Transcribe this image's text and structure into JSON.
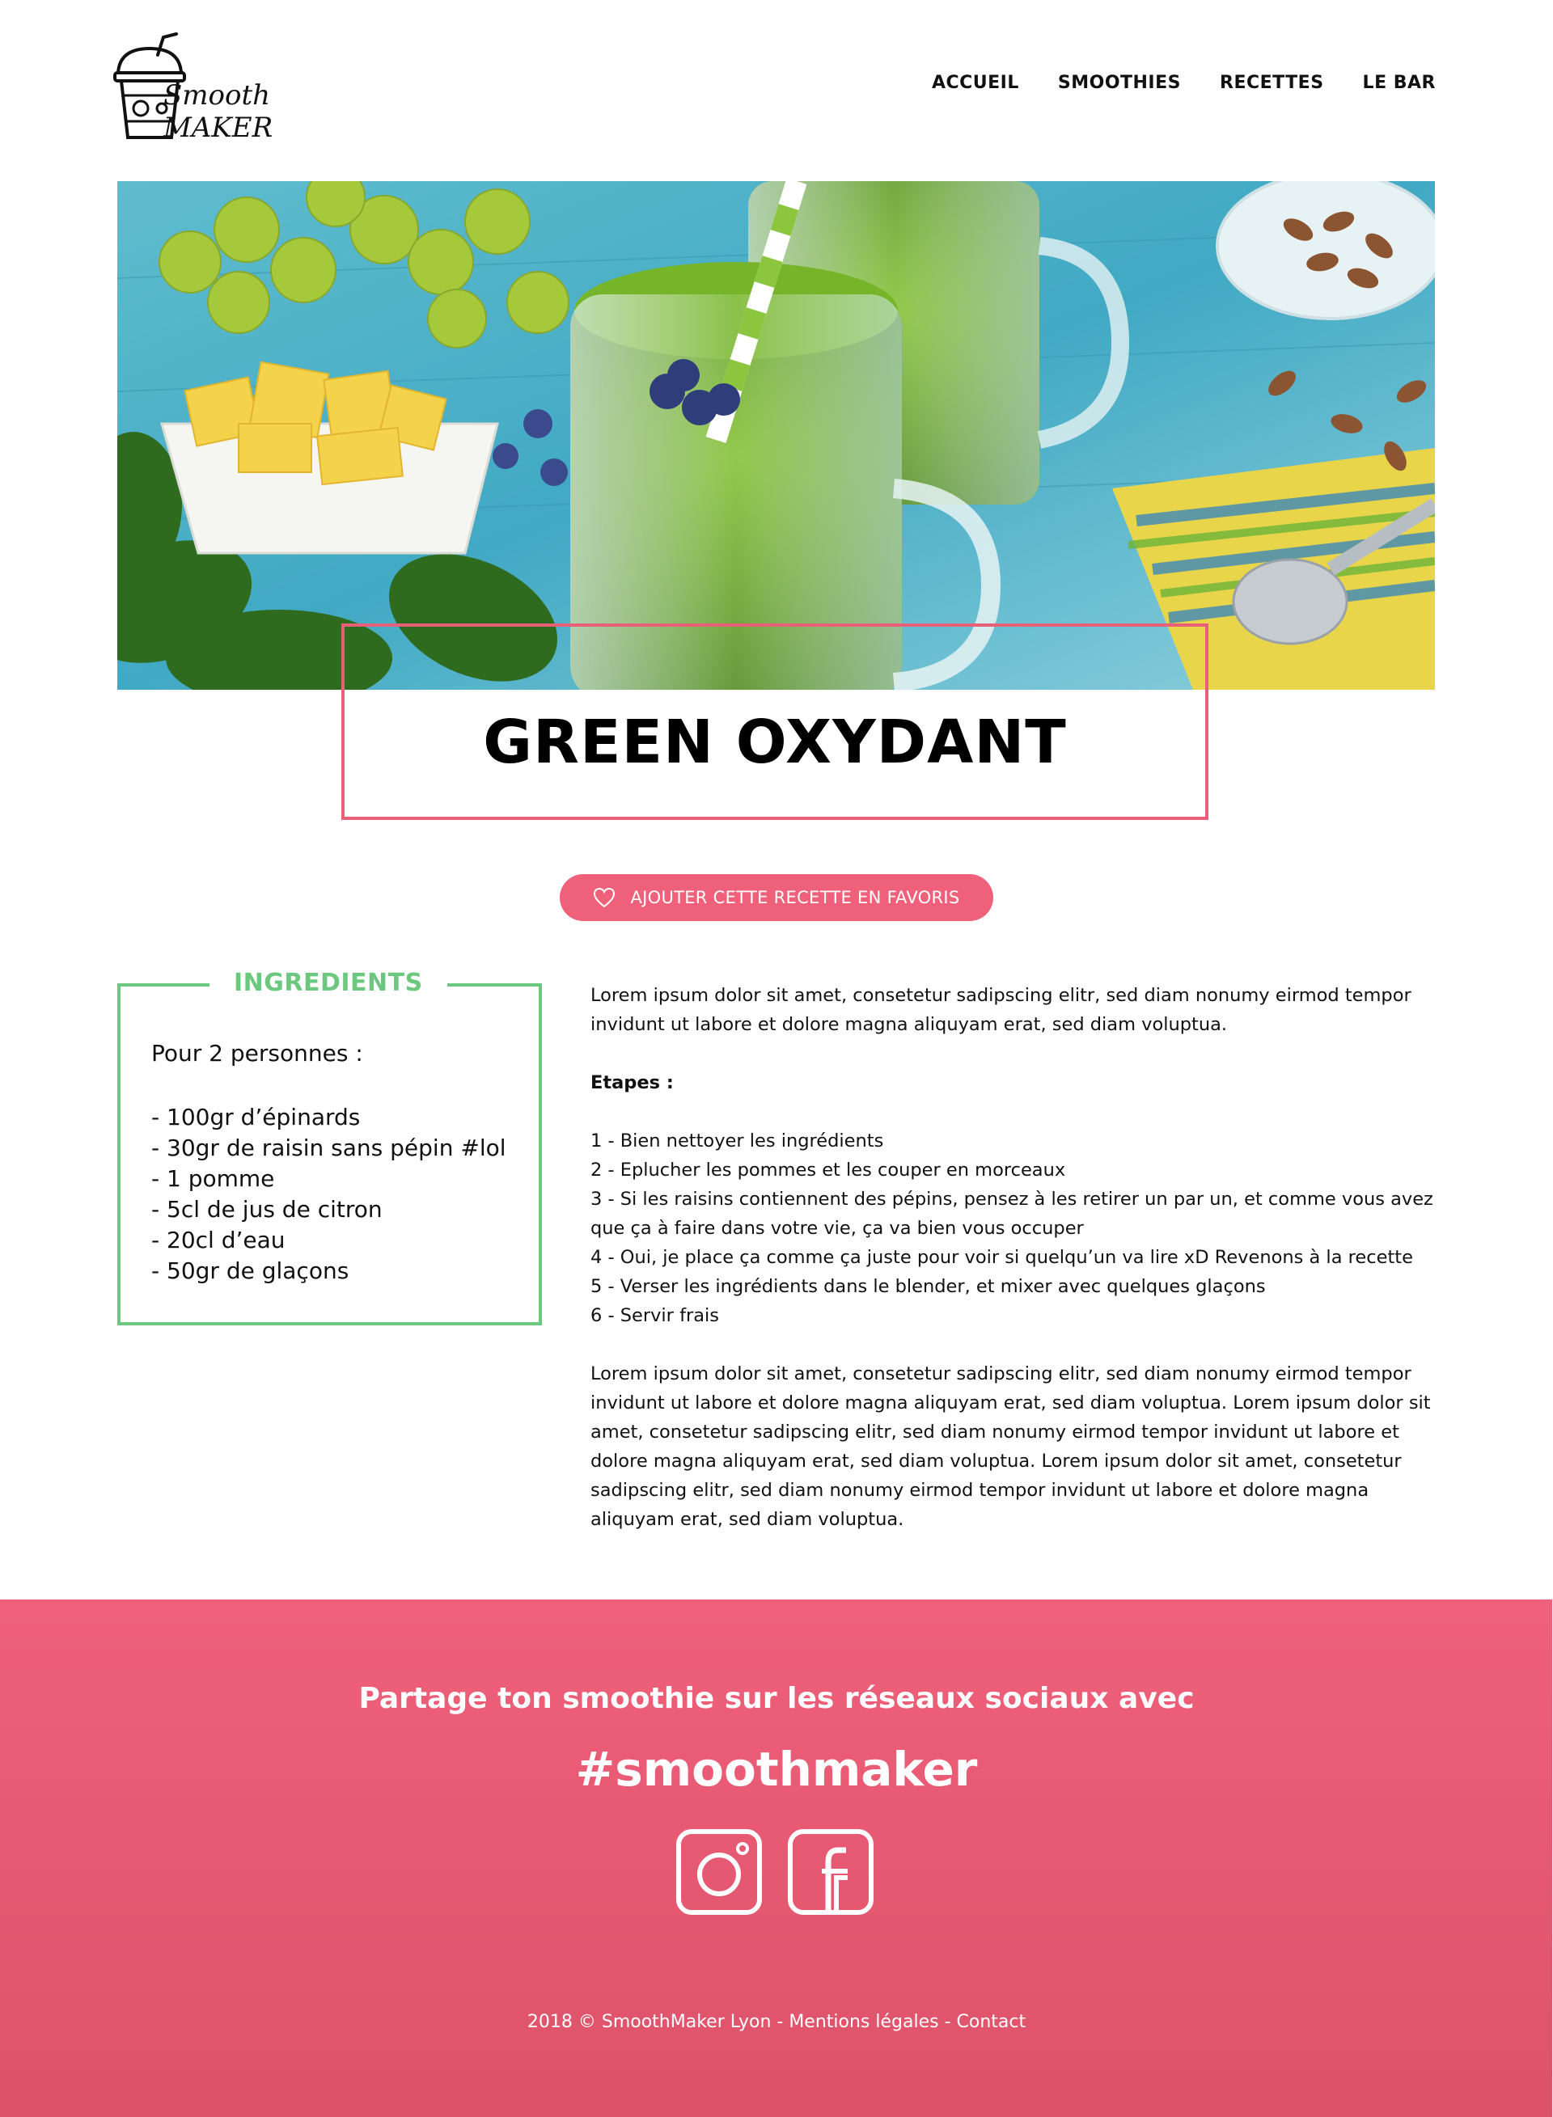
{
  "header": {
    "logo_text": "Smooth MAKER",
    "nav": [
      "ACCUEIL",
      "SMOOTHIES",
      "RECETTES",
      "LE BAR"
    ]
  },
  "recipe": {
    "title": "GREEN OXYDANT",
    "favorite_label": "AJOUTER CETTE RECETTE EN FAVORIS",
    "ingredients": {
      "heading": "INGREDIENTS",
      "servings": "Pour 2 personnes :",
      "items": [
        "- 100gr d’épinards",
        "- 30gr de raisin sans pépin #lol",
        "- 1 pomme",
        "- 5cl de jus de citron",
        "- 20cl d’eau",
        "- 50gr de glaçons"
      ]
    },
    "intro": "Lorem ipsum dolor sit amet, consetetur sadipscing elitr, sed diam nonumy eirmod tempor invidunt ut labore et dolore magna aliquyam erat, sed diam voluptua.",
    "steps_label": "Etapes :",
    "steps": [
      "1 - Bien nettoyer les ingrédients",
      "2 - Eplucher les pommes et les couper en morceaux",
      "3 - Si les raisins contiennent des pépins, pensez à les retirer un par un, et comme vous avez que ça à faire dans votre vie, ça va bien vous occuper",
      "4 - Oui, je place ça comme ça juste pour voir si quelqu’un va lire xD Revenons à la recette",
      "5 - Verser les ingrédients dans le blender, et mixer avec quelques glaçons",
      "6 - Servir frais"
    ],
    "outro": "Lorem ipsum dolor sit amet, consetetur sadipscing elitr, sed diam nonumy eirmod tempor invidunt ut labore et dolore magna aliquyam erat, sed diam voluptua. Lorem ipsum dolor sit amet, consetetur sadipscing elitr, sed diam nonumy eirmod tempor invidunt ut labore et dolore magna aliquyam erat, sed diam voluptua. Lorem ipsum dolor sit amet, consetetur sadipscing elitr, sed diam nonumy eirmod tempor invidunt ut labore et dolore magna aliquyam erat, sed diam voluptua."
  },
  "footer": {
    "share_text": "Partage ton smoothie sur les réseaux sociaux avec",
    "hashtag": "#smoothmaker",
    "social_icons": [
      "instagram-icon",
      "facebook-icon"
    ],
    "copyright": "2018 © SmoothMaker Lyon - Mentions légales - Contact"
  },
  "colors": {
    "accent_pink": "#ef617b",
    "accent_green": "#6cc87f"
  }
}
